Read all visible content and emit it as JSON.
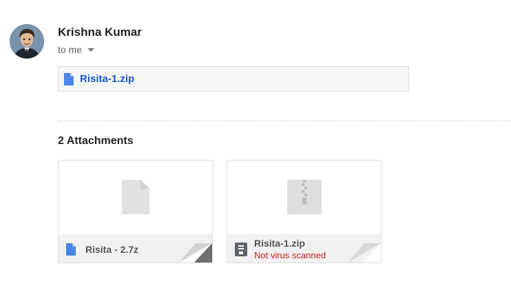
{
  "sender": {
    "name": "Krishna Kumar",
    "recipient_label": "to me"
  },
  "inline_attachment": {
    "filename": "Risita-1.zip",
    "icon": "doc-file-icon"
  },
  "attachments": {
    "heading": "2 Attachments",
    "items": [
      {
        "name": "Risita - 2.7z",
        "icon": "doc-file-icon",
        "preview_icon": "file-icon"
      },
      {
        "name": "Risita-1.zip",
        "warning": "Not virus scanned",
        "icon": "archive-icon",
        "preview_icon": "zip-file-icon"
      }
    ]
  },
  "colors": {
    "link": "#1a57c9",
    "warning": "#c5221f",
    "doc_blue": "#4a86e8"
  }
}
